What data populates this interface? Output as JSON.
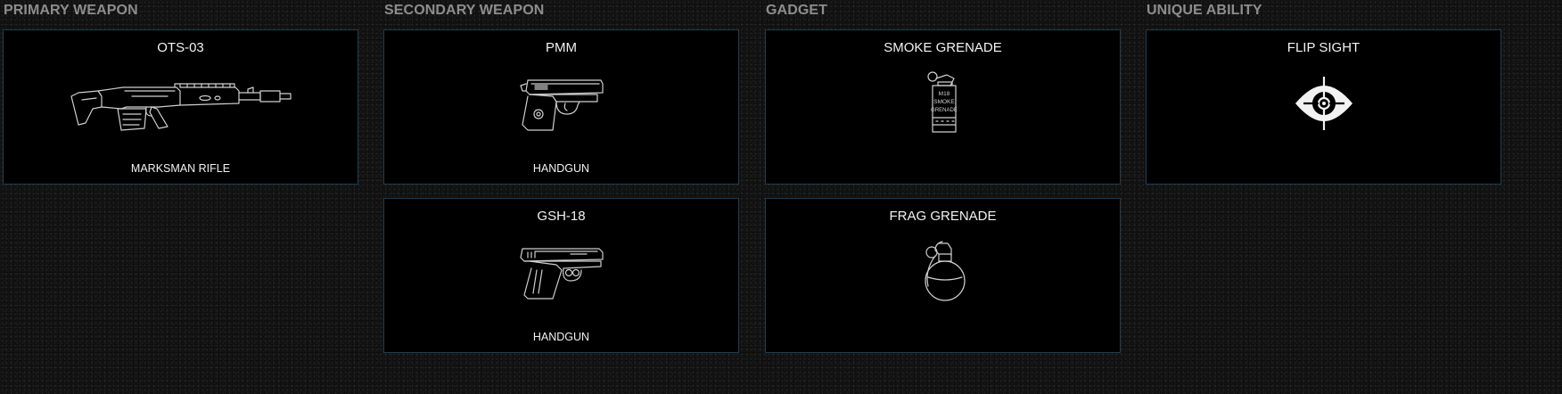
{
  "columns": [
    {
      "title": "PRIMARY WEAPON",
      "cards": [
        {
          "name": "OTS-03",
          "type": "MARKSMAN RIFLE",
          "icon": "rifle-icon"
        }
      ]
    },
    {
      "title": "SECONDARY WEAPON",
      "cards": [
        {
          "name": "PMM",
          "type": "HANDGUN",
          "icon": "pistol-icon"
        },
        {
          "name": "GSH-18",
          "type": "HANDGUN",
          "icon": "pistol-icon"
        }
      ]
    },
    {
      "title": "GADGET",
      "cards": [
        {
          "name": "SMOKE GRENADE",
          "icon": "smoke-grenade-icon",
          "icon_text": [
            "M18",
            "SMOKE",
            "GRENADE"
          ]
        },
        {
          "name": "FRAG GRENADE",
          "icon": "frag-grenade-icon"
        }
      ]
    },
    {
      "title": "UNIQUE ABILITY",
      "cards": [
        {
          "name": "FLIP SIGHT",
          "icon": "flip-sight-icon"
        }
      ]
    }
  ],
  "colors": {
    "background": "#141414",
    "card_background": "#000000",
    "card_border": "#1f3d52",
    "title_text": "#8d8d8d",
    "card_text": "#f2f2f2"
  }
}
